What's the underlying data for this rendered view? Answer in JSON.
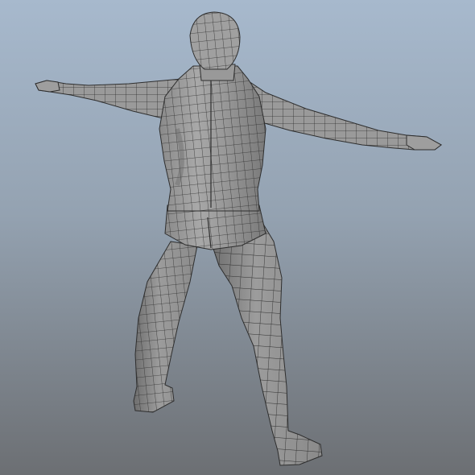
{
  "viewport": {
    "background": {
      "top": "#a7b9cd",
      "middle": "#94a2b1",
      "bottom": "#6c6f73"
    }
  },
  "model": {
    "shading": {
      "light": "#a4a4a4",
      "mid": "#8e8e8e",
      "dark": "#707070",
      "wireframe": "#2e2e2e"
    }
  }
}
